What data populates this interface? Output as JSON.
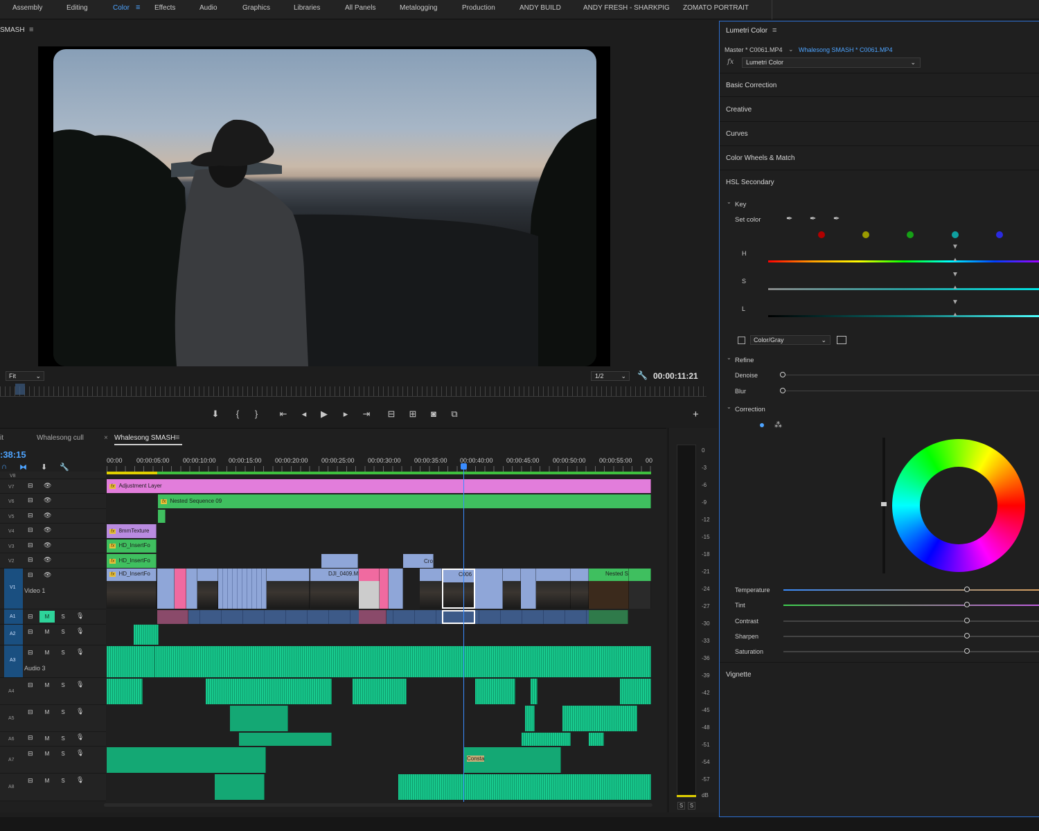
{
  "workspaces": [
    "Assembly",
    "Editing",
    "Color",
    "Effects",
    "Audio",
    "Graphics",
    "Libraries",
    "All Panels",
    "Metalogging",
    "Production",
    "ANDY BUILD",
    "ANDY FRESH - SHARKPIG",
    "ZOMATO PORTRAIT"
  ],
  "active_workspace": "Color",
  "program": {
    "title": "SMASH",
    "zoom": "Fit",
    "resolution": "1/2",
    "timecode": "00:00:11:21"
  },
  "transport_icons": [
    "marker-icon",
    "mark-in-icon",
    "mark-out-icon",
    "go-to-in-icon",
    "step-back-icon",
    "play-icon",
    "step-forward-icon",
    "go-to-out-icon",
    "lift-icon",
    "extract-icon",
    "export-frame-icon",
    "comparison-view-icon"
  ],
  "timeline": {
    "tabs": [
      "it",
      "Whalesong cull",
      "Whalesong SMASH"
    ],
    "active_tab": "Whalesong SMASH",
    "timecode": ":38:15",
    "ruler": [
      "00:00",
      "00:00:05:00",
      "00:00:10:00",
      "00:00:15:00",
      "00:00:20:00",
      "00:00:25:00",
      "00:00:30:00",
      "00:00:35:00",
      "00:00:40:00",
      "00:00:45:00",
      "00:00:50:00",
      "00:00:55:00",
      "00"
    ],
    "video_tracks": [
      "V8",
      "V7",
      "V6",
      "V5",
      "V4",
      "V3",
      "V2",
      "V1"
    ],
    "v1_name": "Video 1",
    "audio_tracks": [
      "A1",
      "A2",
      "A3",
      "A4",
      "A5",
      "A6",
      "A7",
      "A8"
    ],
    "a3_name": "Audio 3",
    "m_label": "M",
    "s_label": "S",
    "clips": {
      "adjustment": "Adjustment Layer",
      "nested": "Nested Sequence 09",
      "texture": "8mmTexture",
      "insert1": "HD_InsertFo",
      "insert2": "HD_InsertFo",
      "insert3": "HD_InsertFo",
      "dji": "DJI_0409.M",
      "c006": "C006",
      "nested_s": "Nested S",
      "cro": "Cro",
      "consta": "Consta"
    }
  },
  "meter": {
    "scale": [
      "0",
      "-3",
      "-6",
      "-9",
      "-12",
      "-15",
      "-18",
      "-21",
      "-24",
      "-27",
      "-30",
      "-33",
      "-36",
      "-39",
      "-42",
      "-45",
      "-48",
      "-51",
      "-54",
      "-57",
      "dB"
    ],
    "solo_left": "S",
    "solo_right": "S"
  },
  "lumetri": {
    "title": "Lumetri Color",
    "master": "Master * C0061.MP4",
    "active_clip": "Whalesong SMASH * C0061.MP4",
    "effect": "Lumetri Color",
    "sections": [
      "Basic Correction",
      "Creative",
      "Curves",
      "Color Wheels & Match",
      "HSL Secondary"
    ],
    "key": {
      "title": "Key",
      "set_color": "Set color",
      "swatches": [
        "#b00000",
        "#9a9a00",
        "#16a016",
        "#0fa0a0",
        "#2a2ae0"
      ],
      "h": "H",
      "s": "S",
      "l": "L",
      "color_gray_mode": "Color/Gray"
    },
    "refine": {
      "title": "Refine",
      "denoise": "Denoise",
      "blur": "Blur"
    },
    "correction": {
      "title": "Correction",
      "sliders": [
        {
          "label": "Temperature",
          "value": 0
        },
        {
          "label": "Tint",
          "value": 0
        },
        {
          "label": "Contrast",
          "value": 0
        },
        {
          "label": "Sharpen",
          "value": 0
        },
        {
          "label": "Saturation",
          "value": 100
        }
      ]
    },
    "vignette": "Vignette"
  }
}
